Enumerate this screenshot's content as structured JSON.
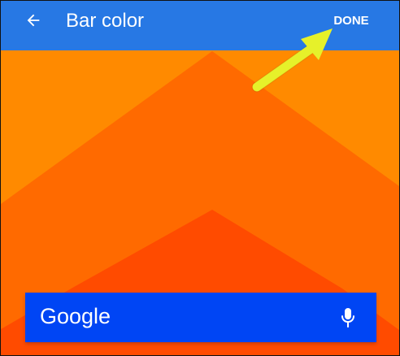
{
  "header": {
    "title": "Bar color",
    "done_label": "DONE",
    "back_icon": "arrow-back-icon"
  },
  "search_widget": {
    "logo_text": "Google",
    "mic_icon": "mic-icon"
  },
  "colors": {
    "top_bar": "#2778e4",
    "wallpaper_background": "#ff8a00",
    "wallpaper_mid": "#ff6a00",
    "wallpaper_inner": "#ff4b00",
    "search_bar": "#0045f4",
    "annotation_arrow": "#e6f12a"
  }
}
